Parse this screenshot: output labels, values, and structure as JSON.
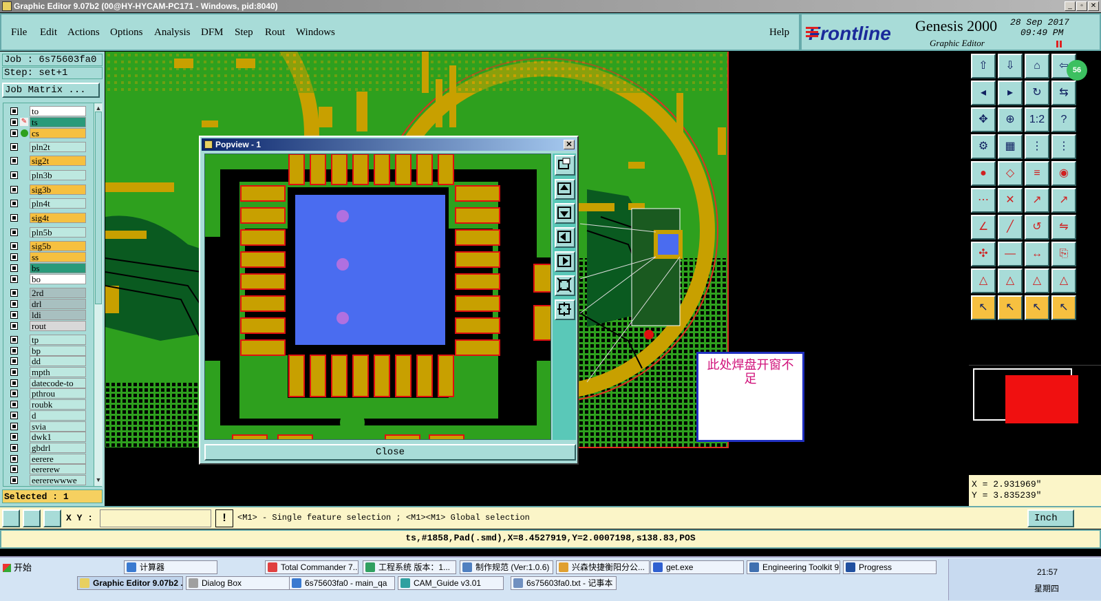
{
  "window": {
    "title": "Graphic Editor 9.07b2 (00@HY-HYCAM-PC171 - Windows, pid:8040)"
  },
  "menu": {
    "items": [
      "File",
      "Edit",
      "Actions",
      "Options",
      "Analysis",
      "DFM",
      "Step",
      "Rout",
      "Windows"
    ],
    "help": "Help"
  },
  "brand": {
    "logo": "Frontline",
    "product": "Genesis 2000",
    "subtitle": "Graphic Editor",
    "date": "28 Sep 2017",
    "time": "09:49 PM"
  },
  "job": {
    "job_label": "Job : 6s75603fa0",
    "step_label": "Step: set+1",
    "matrix_button": "Job Matrix ..."
  },
  "layers": [
    "to",
    "ts",
    "cs",
    "pln2t",
    "sig2t",
    "pln3b",
    "sig3b",
    "pln4t",
    "sig4t",
    "pln5b",
    "sig5b",
    "ss",
    "bs",
    "bo",
    "2rd",
    "drl",
    "ldi",
    "rout",
    "tp",
    "bp",
    "dd",
    "mpth",
    "datecode-to",
    "pthrou",
    "roubk",
    "d",
    "svia",
    "dwk1",
    "gbdrl",
    "eerere",
    "eererew",
    "eererewwwe"
  ],
  "selected": "Selected : 1",
  "popview": {
    "title": "Popview - 1",
    "close_label": "Close"
  },
  "annotation": {
    "text": "此处焊盘开窗不足"
  },
  "coords": {
    "x": "X =  2.931969\"",
    "y": "Y =  3.835239\""
  },
  "status": {
    "xy_label": "X Y :",
    "xy_value": "",
    "hint": "<M1> - Single feature selection ; <M1><M1> Global selection",
    "units": "Inch"
  },
  "info": {
    "text": "ts,#1858,Pad(.smd),X=8.4527919,Y=2.0007198,s138.83,POS"
  },
  "badge": {
    "text": "56"
  },
  "taskbar": {
    "start": "开始",
    "row1": [
      "计算器",
      "Total Commander 7....",
      "工程系统  版本：1...",
      "制作规范 (Ver:1.0.6)",
      "兴森快捷衡阳分公...",
      "get.exe",
      "Engineering Toolkit 9...",
      "Progress"
    ],
    "row2": [
      "Graphic Editor 9.07b2 ...",
      "Dialog Box",
      "6s75603fa0 - main_qa",
      "CAM_Guide v3.01",
      "6s75603fa0.txt - 记事本"
    ],
    "clock": "21:57",
    "weekday": "星期四"
  },
  "colors": {
    "board_green": "#2ea01e",
    "copper": "#c8a000",
    "pad_blue": "#4a6cf0",
    "panel_bg": "#a8dcd8",
    "status_bg": "#fbf5c8"
  }
}
